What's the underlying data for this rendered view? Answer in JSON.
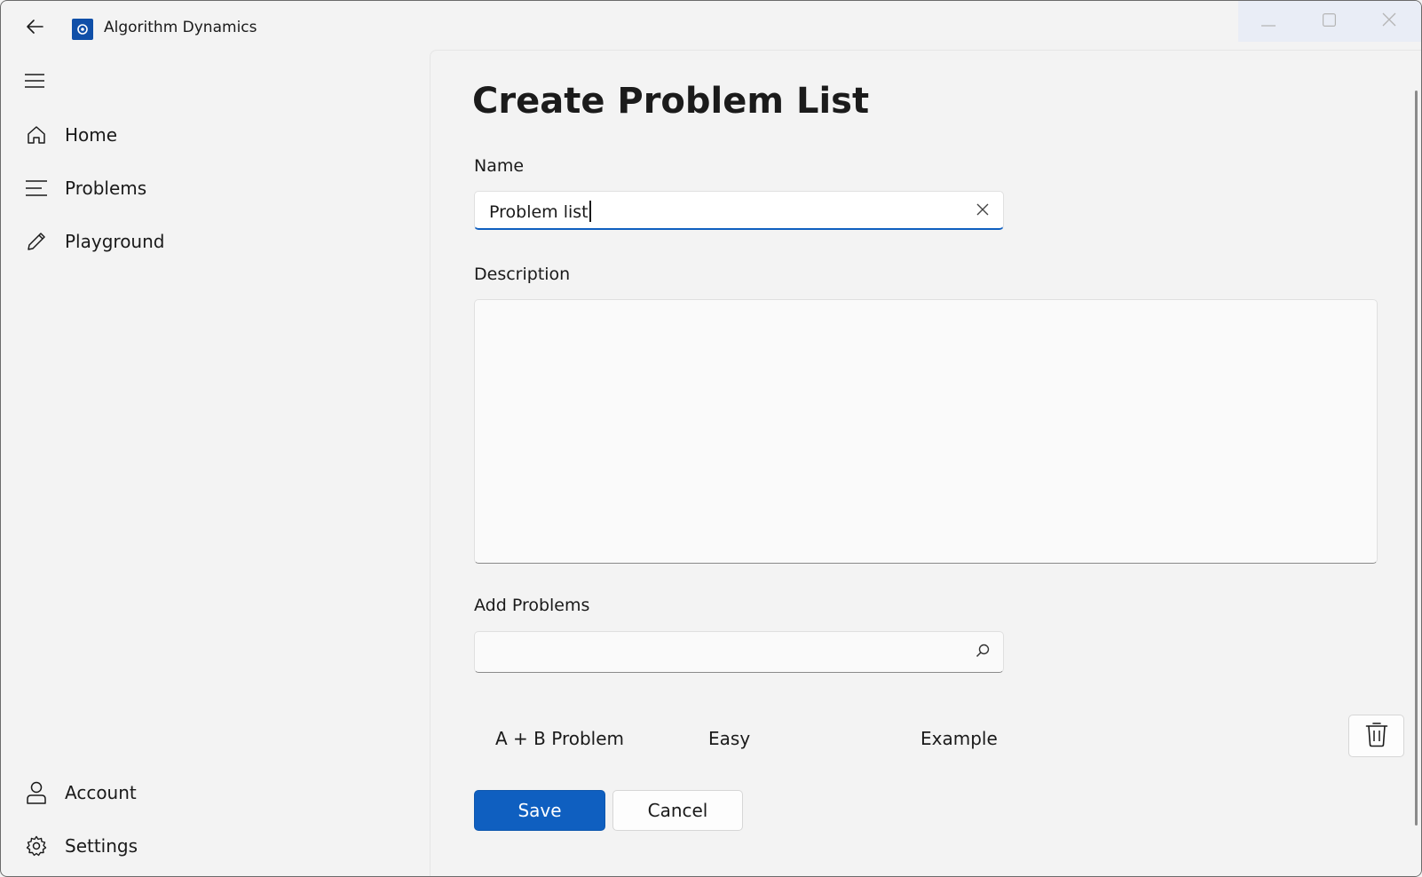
{
  "window": {
    "app_title": "Algorithm Dynamics"
  },
  "nav": {
    "items": [
      {
        "label": "Home",
        "icon": "home-icon"
      },
      {
        "label": "Problems",
        "icon": "list-icon"
      },
      {
        "label": "Playground",
        "icon": "pencil-icon"
      }
    ],
    "footer_items": [
      {
        "label": "Account",
        "icon": "person-icon"
      },
      {
        "label": "Settings",
        "icon": "gear-icon"
      }
    ]
  },
  "page": {
    "title": "Create Problem List",
    "name_label": "Name",
    "name_value": "Problem list",
    "description_label": "Description",
    "description_value": "",
    "add_problems_label": "Add Problems",
    "search_value": "",
    "problems": [
      {
        "title": "A + B Problem",
        "difficulty": "Easy",
        "tag": "Example"
      }
    ],
    "save_label": "Save",
    "cancel_label": "Cancel"
  },
  "colors": {
    "accent": "#0f5fc0",
    "background": "#f3f3f3"
  }
}
